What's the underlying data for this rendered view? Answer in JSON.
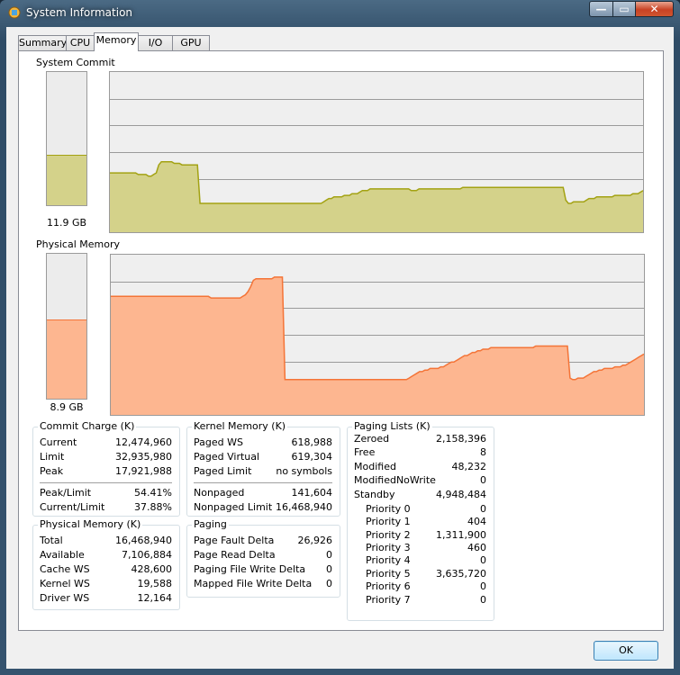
{
  "window": {
    "title": "System Information",
    "min_glyph": "—",
    "max_glyph": "▭",
    "close_glyph": "✕"
  },
  "tabs": [
    "Summary",
    "CPU",
    "Memory",
    "I/O",
    "GPU"
  ],
  "active_tab": "Memory",
  "system_commit": {
    "label": "System Commit",
    "bar_value": "11.9 GB",
    "bar_level": 0.37,
    "color_fill": "#d4d28a",
    "color_line": "#a3a213",
    "history": [
      0.37,
      0.37,
      0.37,
      0.37,
      0.37,
      0.37,
      0.37,
      0.37,
      0.37,
      0.37,
      0.37,
      0.36,
      0.36,
      0.36,
      0.36,
      0.35,
      0.35,
      0.36,
      0.37,
      0.42,
      0.44,
      0.44,
      0.44,
      0.44,
      0.44,
      0.43,
      0.43,
      0.43,
      0.42,
      0.42,
      0.42,
      0.42,
      0.42,
      0.42,
      0.42,
      0.18,
      0.18,
      0.18,
      0.18,
      0.18,
      0.18,
      0.18,
      0.18,
      0.18,
      0.18,
      0.18,
      0.18,
      0.18,
      0.18,
      0.18,
      0.18,
      0.18,
      0.18,
      0.18,
      0.18,
      0.18,
      0.18,
      0.18,
      0.18,
      0.18,
      0.18,
      0.18,
      0.18,
      0.18,
      0.18,
      0.18,
      0.18,
      0.18,
      0.18,
      0.18,
      0.18,
      0.18,
      0.18,
      0.18,
      0.18,
      0.18,
      0.18,
      0.18,
      0.18,
      0.18,
      0.18,
      0.18,
      0.18,
      0.19,
      0.2,
      0.21,
      0.21,
      0.22,
      0.22,
      0.22,
      0.22,
      0.23,
      0.23,
      0.23,
      0.24,
      0.24,
      0.24,
      0.25,
      0.26,
      0.26,
      0.26,
      0.27,
      0.27,
      0.27,
      0.27,
      0.27,
      0.27,
      0.27,
      0.27,
      0.27,
      0.27,
      0.27,
      0.27,
      0.27,
      0.27,
      0.27,
      0.27,
      0.26,
      0.26,
      0.26,
      0.27,
      0.27,
      0.27,
      0.27,
      0.27,
      0.27,
      0.27,
      0.27,
      0.27,
      0.27,
      0.27,
      0.27,
      0.27,
      0.27,
      0.27,
      0.27,
      0.27,
      0.28,
      0.28,
      0.28,
      0.28,
      0.28,
      0.28,
      0.28,
      0.28,
      0.28,
      0.28,
      0.28,
      0.28,
      0.28,
      0.28,
      0.28,
      0.28,
      0.28,
      0.28,
      0.28,
      0.28,
      0.28,
      0.28,
      0.28,
      0.28,
      0.28,
      0.28,
      0.28,
      0.28,
      0.28,
      0.28,
      0.28,
      0.28,
      0.28,
      0.28,
      0.28,
      0.28,
      0.28,
      0.28,
      0.28,
      0.28,
      0.2,
      0.18,
      0.18,
      0.19,
      0.19,
      0.19,
      0.19,
      0.19,
      0.2,
      0.21,
      0.21,
      0.21,
      0.22,
      0.22,
      0.22,
      0.22,
      0.22,
      0.22,
      0.22,
      0.23,
      0.23,
      0.23,
      0.23,
      0.23,
      0.23,
      0.23,
      0.24,
      0.24,
      0.24,
      0.25,
      0.26
    ]
  },
  "physical_memory_chart": {
    "label": "Physical Memory",
    "bar_value": "8.9 GB",
    "bar_level": 0.54,
    "color_fill": "#fdb690",
    "color_line": "#f47437",
    "history": [
      0.74,
      0.74,
      0.74,
      0.74,
      0.74,
      0.74,
      0.74,
      0.74,
      0.74,
      0.74,
      0.74,
      0.74,
      0.74,
      0.74,
      0.74,
      0.74,
      0.74,
      0.74,
      0.74,
      0.74,
      0.74,
      0.74,
      0.74,
      0.74,
      0.74,
      0.74,
      0.74,
      0.74,
      0.74,
      0.74,
      0.74,
      0.74,
      0.74,
      0.74,
      0.74,
      0.74,
      0.74,
      0.74,
      0.73,
      0.73,
      0.73,
      0.73,
      0.73,
      0.73,
      0.73,
      0.73,
      0.73,
      0.73,
      0.73,
      0.73,
      0.74,
      0.75,
      0.77,
      0.8,
      0.84,
      0.85,
      0.85,
      0.85,
      0.85,
      0.85,
      0.85,
      0.85,
      0.86,
      0.86,
      0.86,
      0.86,
      0.22,
      0.22,
      0.22,
      0.22,
      0.22,
      0.22,
      0.22,
      0.22,
      0.22,
      0.22,
      0.22,
      0.22,
      0.22,
      0.22,
      0.22,
      0.22,
      0.22,
      0.22,
      0.22,
      0.22,
      0.22,
      0.22,
      0.22,
      0.22,
      0.22,
      0.22,
      0.22,
      0.22,
      0.22,
      0.22,
      0.22,
      0.22,
      0.22,
      0.22,
      0.22,
      0.22,
      0.22,
      0.22,
      0.22,
      0.22,
      0.22,
      0.22,
      0.22,
      0.22,
      0.22,
      0.22,
      0.22,
      0.23,
      0.24,
      0.25,
      0.26,
      0.27,
      0.27,
      0.28,
      0.28,
      0.29,
      0.29,
      0.29,
      0.29,
      0.3,
      0.3,
      0.31,
      0.32,
      0.33,
      0.33,
      0.34,
      0.35,
      0.36,
      0.37,
      0.37,
      0.38,
      0.39,
      0.39,
      0.4,
      0.4,
      0.41,
      0.41,
      0.41,
      0.42,
      0.42,
      0.42,
      0.42,
      0.42,
      0.42,
      0.42,
      0.42,
      0.42,
      0.42,
      0.42,
      0.42,
      0.42,
      0.42,
      0.42,
      0.42,
      0.42,
      0.43,
      0.43,
      0.43,
      0.43,
      0.43,
      0.43,
      0.43,
      0.43,
      0.43,
      0.43,
      0.43,
      0.43,
      0.43,
      0.23,
      0.22,
      0.22,
      0.23,
      0.23,
      0.23,
      0.24,
      0.25,
      0.26,
      0.27,
      0.27,
      0.28,
      0.28,
      0.29,
      0.29,
      0.29,
      0.29,
      0.3,
      0.3,
      0.3,
      0.31,
      0.31,
      0.32,
      0.33,
      0.34,
      0.35,
      0.36,
      0.37,
      0.38
    ]
  },
  "commit_charge": {
    "title": "Commit Charge (K)",
    "rows": [
      {
        "k": "Current",
        "v": "12,474,960"
      },
      {
        "k": "Limit",
        "v": "32,935,980"
      },
      {
        "k": "Peak",
        "v": "17,921,988"
      }
    ],
    "rows2": [
      {
        "k": "Peak/Limit",
        "v": "54.41%"
      },
      {
        "k": "Current/Limit",
        "v": "37.88%"
      }
    ]
  },
  "physical_memory": {
    "title": "Physical Memory (K)",
    "rows": [
      {
        "k": "Total",
        "v": "16,468,940"
      },
      {
        "k": "Available",
        "v": "7,106,884"
      },
      {
        "k": "Cache WS",
        "v": "428,600"
      },
      {
        "k": "Kernel WS",
        "v": "19,588"
      },
      {
        "k": "Driver WS",
        "v": "12,164"
      }
    ]
  },
  "kernel_memory": {
    "title": "Kernel Memory (K)",
    "rows": [
      {
        "k": "Paged WS",
        "v": "618,988"
      },
      {
        "k": "Paged Virtual",
        "v": "619,304"
      },
      {
        "k": "Paged Limit",
        "v": "no symbols"
      }
    ],
    "rows2": [
      {
        "k": "Nonpaged",
        "v": "141,604"
      },
      {
        "k": "Nonpaged Limit",
        "v": "16,468,940"
      }
    ]
  },
  "paging": {
    "title": "Paging",
    "rows": [
      {
        "k": "Page Fault Delta",
        "v": "26,926"
      },
      {
        "k": "Page Read Delta",
        "v": "0"
      },
      {
        "k": "Paging File Write Delta",
        "v": "0"
      },
      {
        "k": "Mapped File Write Delta",
        "v": "0"
      }
    ]
  },
  "paging_lists": {
    "title": "Paging Lists (K)",
    "rows": [
      {
        "k": "Zeroed",
        "v": "2,158,396"
      },
      {
        "k": "Free",
        "v": "8"
      },
      {
        "k": "Modified",
        "v": "48,232"
      },
      {
        "k": "ModifiedNoWrite",
        "v": "0"
      },
      {
        "k": "Standby",
        "v": "4,948,484"
      }
    ],
    "priorities": [
      {
        "k": "Priority 0",
        "v": "0"
      },
      {
        "k": "Priority 1",
        "v": "404"
      },
      {
        "k": "Priority 2",
        "v": "1,311,900"
      },
      {
        "k": "Priority 3",
        "v": "460"
      },
      {
        "k": "Priority 4",
        "v": "0"
      },
      {
        "k": "Priority 5",
        "v": "3,635,720"
      },
      {
        "k": "Priority 6",
        "v": "0"
      },
      {
        "k": "Priority 7",
        "v": "0"
      }
    ]
  },
  "ok_label": "OK"
}
